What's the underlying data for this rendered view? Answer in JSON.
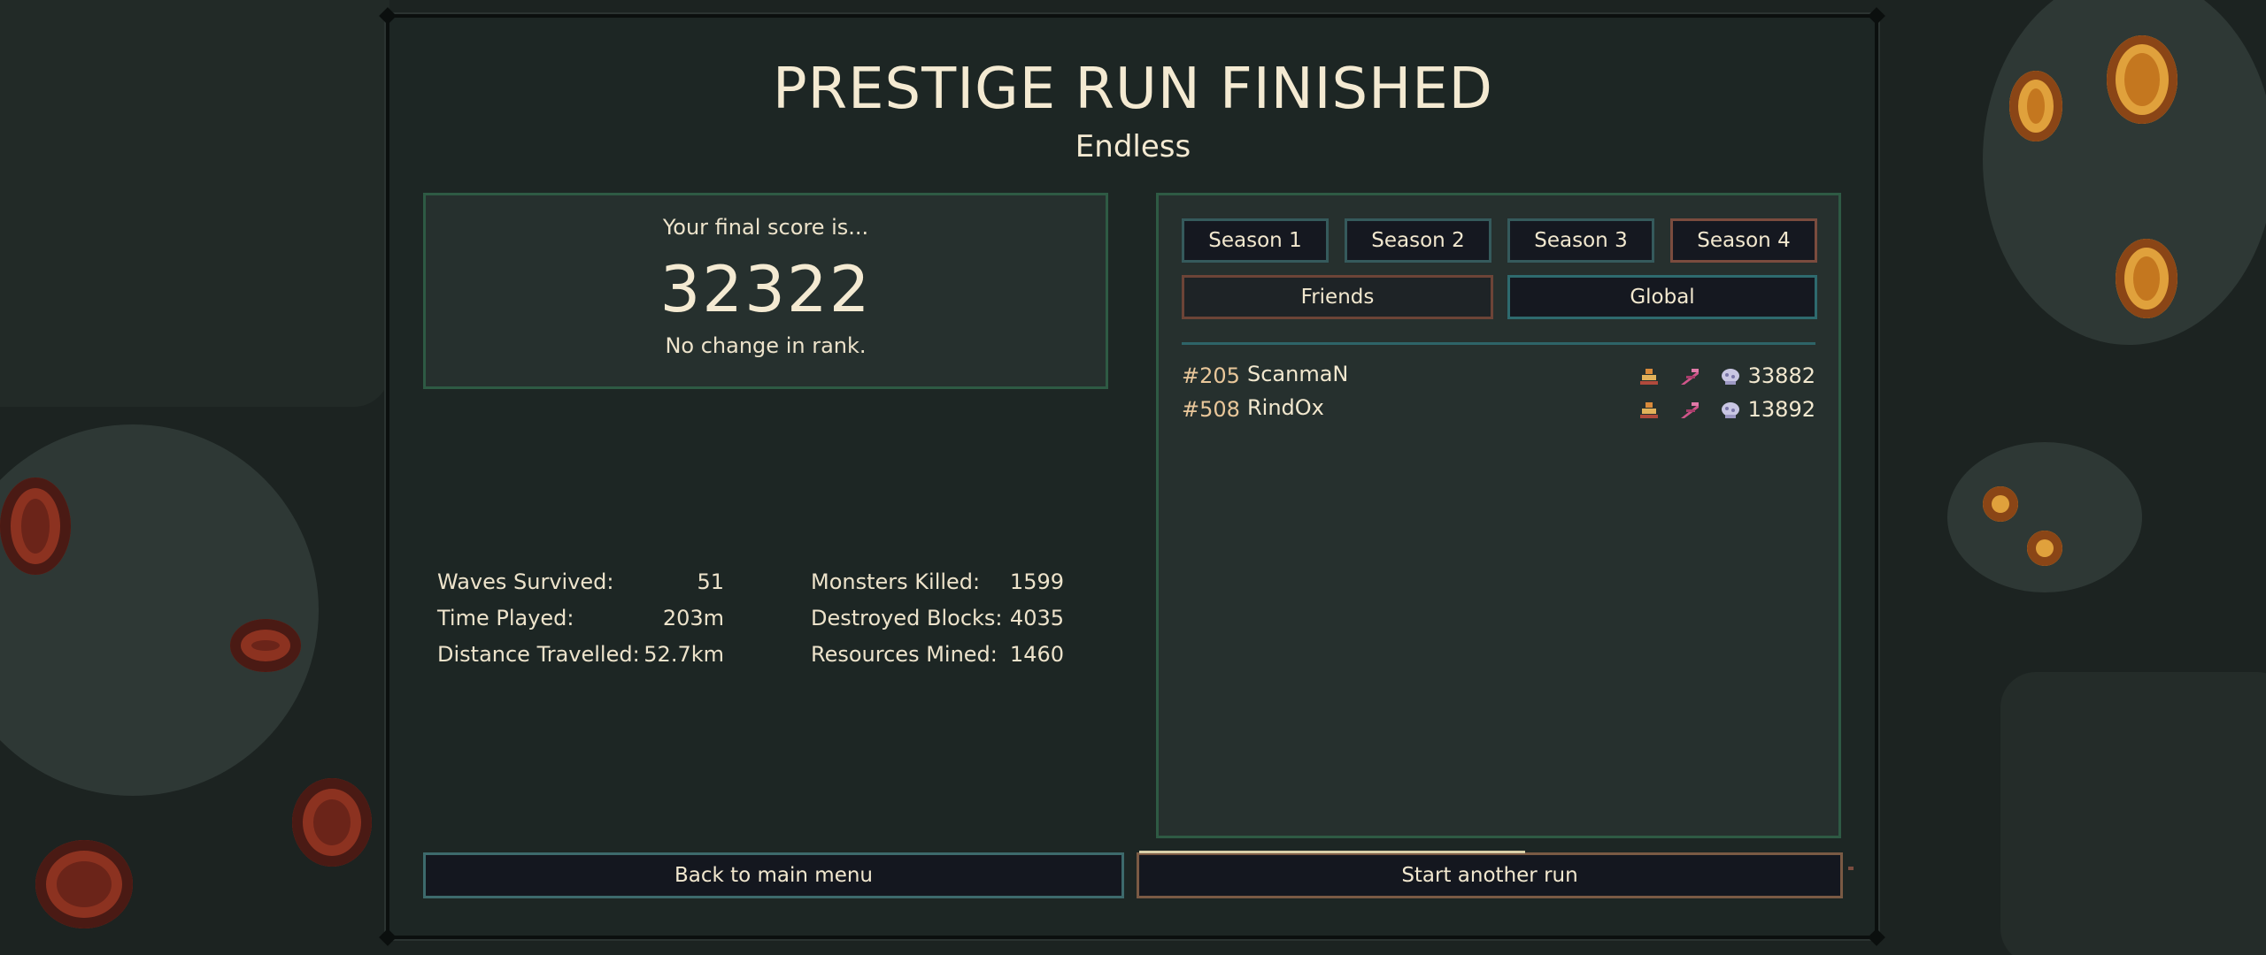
{
  "title": "PRESTIGE RUN FINISHED",
  "mode": "Endless",
  "score": {
    "intro": "Your final score is...",
    "value": "32322",
    "rank_text": "No change in rank."
  },
  "stats": {
    "left": [
      {
        "label": "Waves Survived:",
        "value": "51"
      },
      {
        "label": "Time Played:",
        "value": "203m"
      },
      {
        "label": "Distance Travelled:",
        "value": "52.7km"
      }
    ],
    "right": [
      {
        "label": "Monsters Killed:",
        "value": "1599"
      },
      {
        "label": "Destroyed Blocks:",
        "value": "4035"
      },
      {
        "label": "Resources Mined:",
        "value": "1460"
      }
    ]
  },
  "leaderboard": {
    "seasons": [
      "Season 1",
      "Season 2",
      "Season 3",
      "Season 4"
    ],
    "selected_season": "Season 4",
    "scopes": [
      "Friends",
      "Global"
    ],
    "selected_scope": "Global",
    "entries": [
      {
        "rank": "#205",
        "name": "ScanmaN",
        "icons": [
          "keeper-icon",
          "drill-icon",
          "gadget-icon"
        ],
        "score": "33882"
      },
      {
        "rank": "#508",
        "name": "RindOx",
        "icons": [
          "keeper-icon",
          "drill-icon",
          "gadget-icon"
        ],
        "score": "13892"
      }
    ]
  },
  "buttons": {
    "back": "Back to main menu",
    "start": "Start another run",
    "start_progress": 0.55
  },
  "colors": {
    "panel": "#1d2624",
    "box": "#26302e",
    "box_border": "#2e5a44",
    "text": "#f4ead2",
    "rank_text": "#e9c79a",
    "button_bg": "#14171f"
  }
}
